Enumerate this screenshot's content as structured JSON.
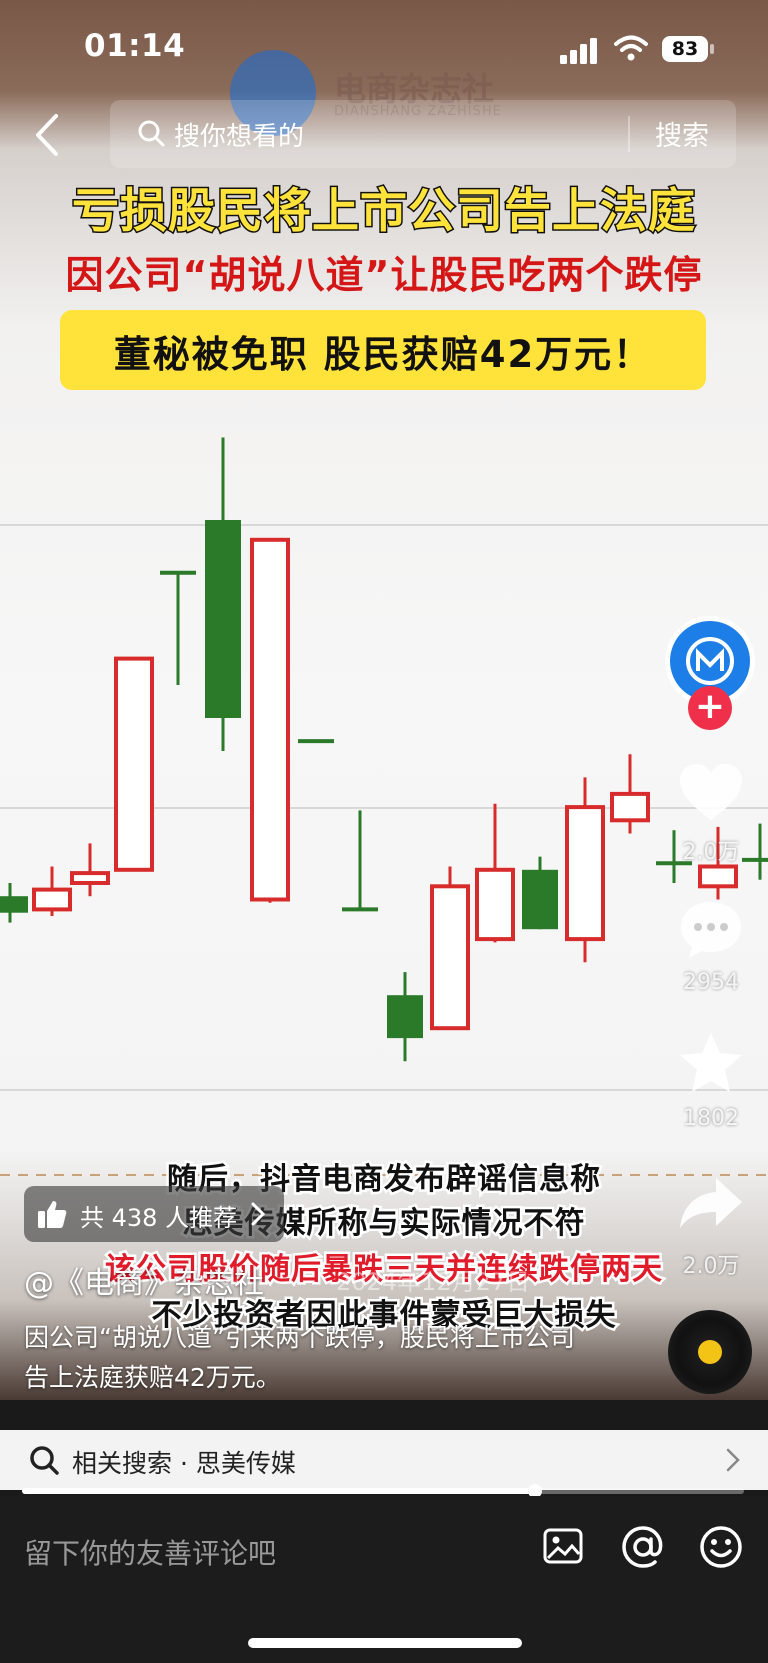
{
  "status_bar": {
    "time": "01:14",
    "battery": "83"
  },
  "search": {
    "placeholder": "搜你想看的",
    "button": "搜索"
  },
  "watermark": {
    "name": "电商杂志社",
    "sub": "DIANSHANG ZAZHISHE"
  },
  "video": {
    "headline_1": "亏损股民将上市公司告上法庭",
    "headline_2": "因公司“胡说八道”让股民吃两个跌停",
    "headline_3": "董秘被免职 股民获赔42万元！",
    "subtitles": [
      "随后，抖音电商发布辟谣信息称",
      "思美传媒所称与实际情况不符",
      "该公司股价随后暴跌三天并连续跌停两天",
      "不少投资者因此事件蒙受巨大损失"
    ],
    "date_ghost": "2024年12月27日"
  },
  "rail": {
    "likes": "2.0万",
    "comments": "2954",
    "favorites": "1802",
    "shares": "2.0万"
  },
  "recommend": {
    "text": "共 438 人推荐"
  },
  "author": {
    "name": "@《电商》杂志社"
  },
  "caption": "因公司“胡说八道”引来两个跌停，股民将上市公司告上法庭获赔42万元。",
  "related": {
    "text": "相关搜索 · 思美传媒"
  },
  "progress": {
    "fraction": 0.71
  },
  "comment_bar": {
    "placeholder": "留下你的友善评论吧"
  },
  "colors": {
    "up": "#d82b2b",
    "down": "#2a7a2a",
    "headline_yellow": "#ffe33a",
    "follow": "#f0304a"
  },
  "chart_data": {
    "type": "candlestick",
    "candles": [
      {
        "open": 4.1,
        "close": 4.6,
        "high": 5.0,
        "low": 3.8,
        "dir": "down"
      },
      {
        "open": 4.2,
        "close": 4.8,
        "high": 5.5,
        "low": 4.0,
        "dir": "up"
      },
      {
        "open": 5.0,
        "close": 5.3,
        "high": 6.2,
        "low": 4.6,
        "dir": "up"
      },
      {
        "open": 5.4,
        "close": 11.8,
        "high": 11.8,
        "low": 5.4,
        "dir": "up"
      },
      {
        "open": 14.4,
        "close": 14.4,
        "high": 14.4,
        "low": 11.0,
        "dir": "flat"
      },
      {
        "open": 16.0,
        "close": 10.0,
        "high": 18.5,
        "low": 9.0,
        "dir": "down"
      },
      {
        "open": 4.5,
        "close": 15.4,
        "high": 15.4,
        "low": 4.4,
        "dir": "up"
      },
      {
        "open": 9.3,
        "close": 9.3,
        "high": 9.3,
        "low": 9.3,
        "dir": "flat"
      },
      {
        "open": 4.2,
        "close": 4.2,
        "high": 7.2,
        "low": 4.2,
        "dir": "flat"
      },
      {
        "open": 1.6,
        "close": 0.3,
        "high": 2.3,
        "low": -0.4,
        "dir": "down"
      },
      {
        "open": 0.6,
        "close": 4.9,
        "high": 5.5,
        "low": 0.6,
        "dir": "up"
      },
      {
        "open": 3.3,
        "close": 5.4,
        "high": 7.4,
        "low": 3.2,
        "dir": "up"
      },
      {
        "open": 3.6,
        "close": 5.4,
        "high": 5.8,
        "low": 3.6,
        "dir": "down"
      },
      {
        "open": 3.3,
        "close": 7.3,
        "high": 8.2,
        "low": 2.6,
        "dir": "up"
      },
      {
        "open": 6.9,
        "close": 7.7,
        "high": 8.9,
        "low": 6.5,
        "dir": "up"
      },
      {
        "open": 5.4,
        "close": 5.6,
        "high": 6.6,
        "low": 5.0,
        "dir": "flat"
      },
      {
        "open": 4.9,
        "close": 5.5,
        "high": 6.7,
        "low": 4.5,
        "dir": "up"
      },
      {
        "open": 5.7,
        "close": 5.7,
        "high": 6.8,
        "low": 5.1,
        "dir": "flat"
      }
    ]
  }
}
